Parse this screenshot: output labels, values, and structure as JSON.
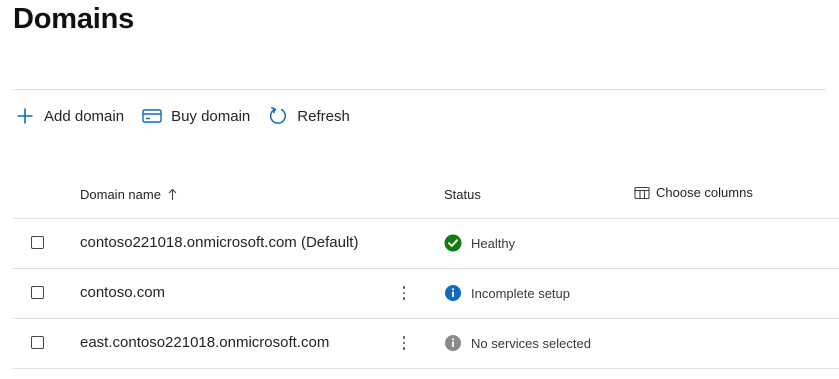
{
  "page": {
    "title": "Domains"
  },
  "toolbar": {
    "add_domain": {
      "label": "Add domain",
      "icon": "plus-icon"
    },
    "buy_domain": {
      "label": "Buy domain",
      "icon": "card-icon"
    },
    "refresh": {
      "label": "Refresh",
      "icon": "refresh-icon"
    }
  },
  "grid": {
    "columns": {
      "domain_name": "Domain name",
      "status": "Status",
      "choose_columns": "Choose columns"
    },
    "sort": {
      "column": "Domain name",
      "direction": "ascending"
    },
    "rows": [
      {
        "domain": "contoso221018.onmicrosoft.com (Default)",
        "status": "Healthy",
        "status_icon": "check-circle-icon",
        "status_color": "#107c10",
        "has_more": false
      },
      {
        "domain": "contoso.com",
        "status": "Incomplete setup",
        "status_icon": "info-circle-icon",
        "status_color": "#0f6cbd",
        "has_more": true
      },
      {
        "domain": "east.contoso221018.onmicrosoft.com",
        "status": "No services selected",
        "status_icon": "info-circle-icon",
        "status_color": "#8a8a8a",
        "has_more": true
      }
    ]
  },
  "colors": {
    "accent": "#0f6cbd",
    "healthy": "#107c10",
    "neutral": "#8a8a8a",
    "divider": "#e1e1e1"
  }
}
